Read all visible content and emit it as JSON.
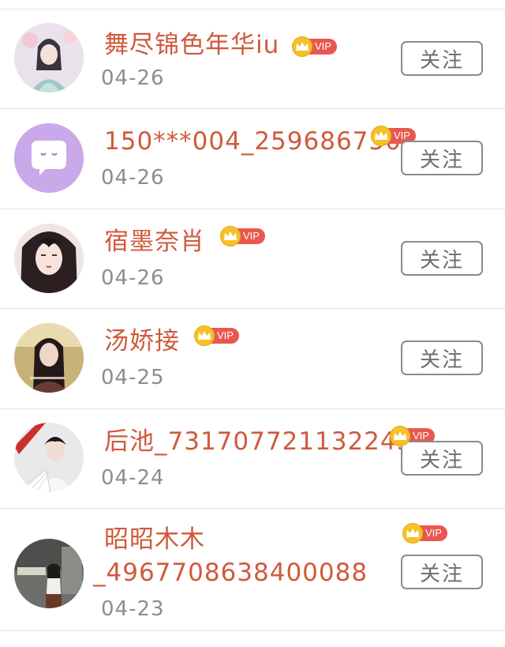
{
  "follow_label": "关注",
  "vip_label": "VIP",
  "colors": {
    "name": "#cf5a3c",
    "date": "#8d8d8d",
    "vip_badge": "#e8584e",
    "crown": "#f4c228",
    "divider": "#e3e3e3"
  },
  "users": [
    {
      "name": "舞尽锦色年华iu",
      "date": "04-26",
      "avatar": "hanfu-girl-avatar"
    },
    {
      "name": "150***004_259686750",
      "date": "04-26",
      "avatar": "default-chat-avatar"
    },
    {
      "name": "宿墨奈肖",
      "date": "04-26",
      "avatar": "illustrated-woman-avatar"
    },
    {
      "name": "汤娇接",
      "date": "04-25",
      "avatar": "woman-portrait-avatar"
    },
    {
      "name": "后池_7317077211322457",
      "date": "04-24",
      "avatar": "man-with-fan-avatar"
    },
    {
      "name_line1": "昭昭木木",
      "name_line2": "_4967708638400088",
      "date": "04-23",
      "avatar": "street-photo-avatar"
    }
  ]
}
